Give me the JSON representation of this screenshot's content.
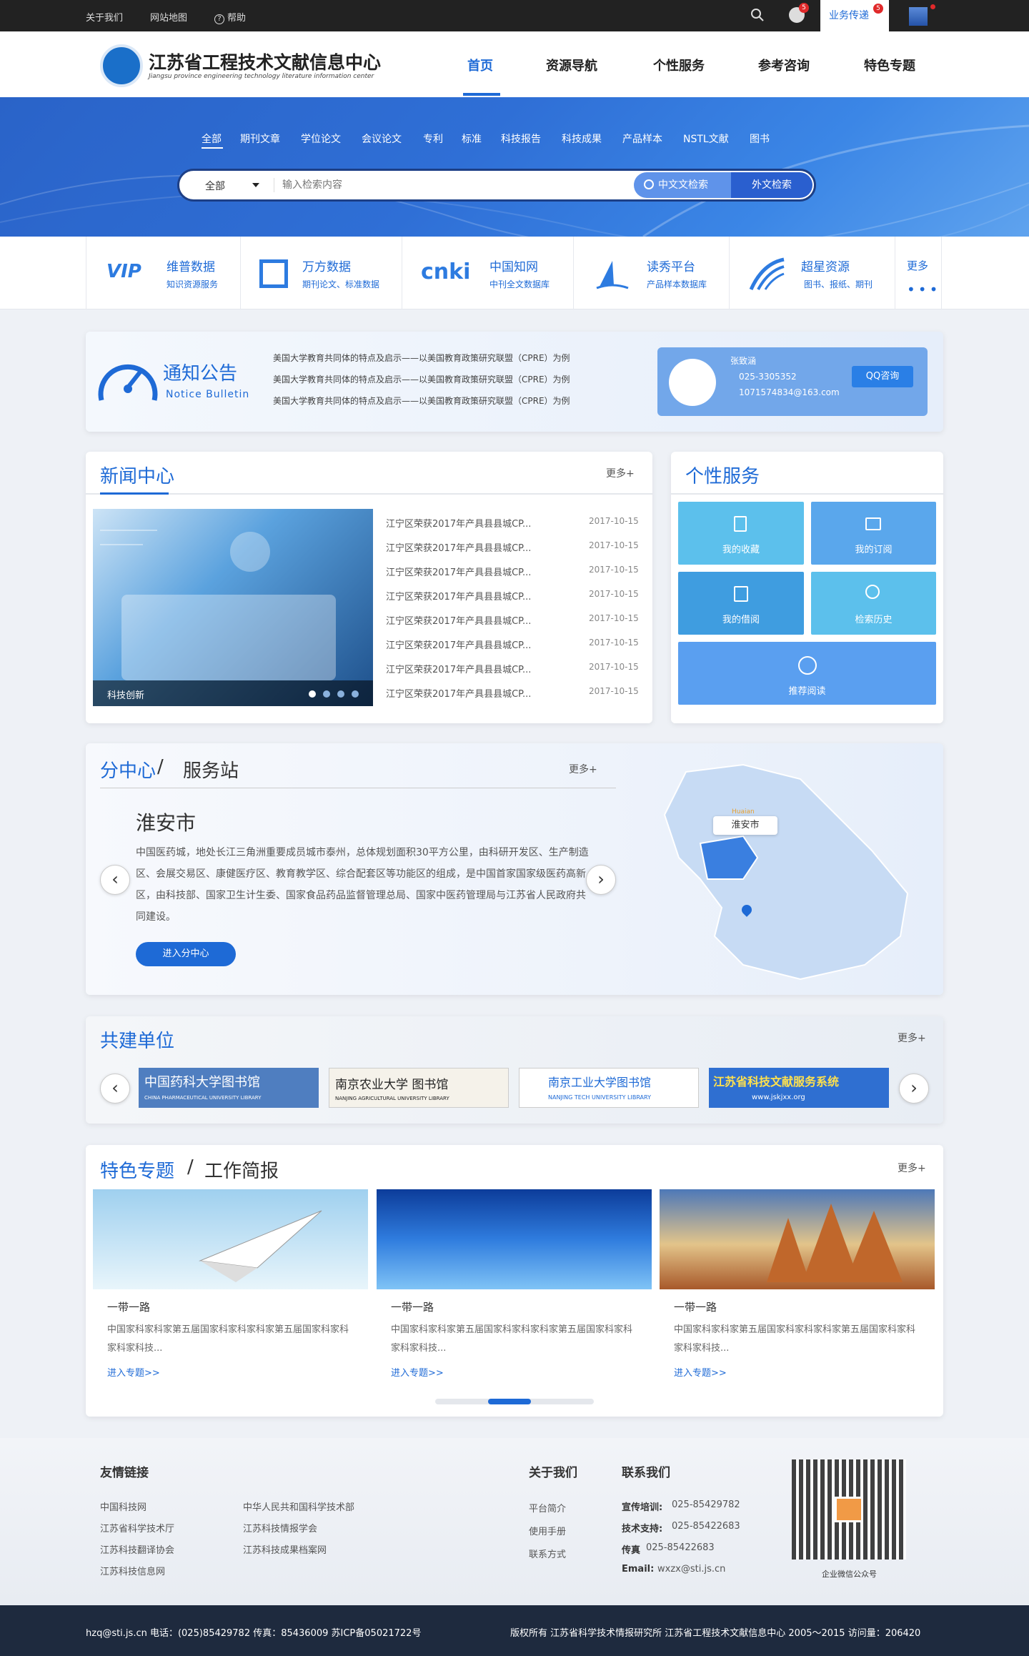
{
  "topbar": {
    "links": [
      "关于我们",
      "网站地图",
      "帮助"
    ],
    "badge_notice": "5",
    "business_tab": "业务传递",
    "badge_business": "5"
  },
  "header": {
    "title": "江苏省工程技术文献信息中心",
    "subtitle": "Jiangsu province engineering technology literature information center",
    "nav": [
      "首页",
      "资源导航",
      "个性服务",
      "参考咨询",
      "特色专题"
    ]
  },
  "search": {
    "categories": [
      "全部",
      "期刊文章",
      "学位论文",
      "会议论文",
      "专利",
      "标准",
      "科技报告",
      "科技成果",
      "产品样本",
      "NSTL文献",
      "图书"
    ],
    "select_value": "全部",
    "placeholder": "输入检索内容",
    "btn_cn": "中文文检索",
    "btn_foreign": "外文检索"
  },
  "quick_links": [
    {
      "title": "维普数据",
      "sub": "知识资源服务",
      "logo": "VIP"
    },
    {
      "title": "万方数据",
      "sub": "期刊论文、标准数据",
      "logo": "WF"
    },
    {
      "title": "中国知网",
      "sub": "中刊全文数据库",
      "logo": "cnki"
    },
    {
      "title": "读秀平台",
      "sub": "产品样本数据库",
      "logo": "DX"
    },
    {
      "title": "超星资源",
      "sub": "图书、报纸、期刊",
      "logo": "CX"
    }
  ],
  "quick_more": "更多",
  "notice": {
    "title_cn": "通知公告",
    "title_en": "Notice Bulletin",
    "items": [
      "美国大学教育共同体的特点及启示——以美国教育政策研究联盟（CPRE）为例",
      "美国大学教育共同体的特点及启示——以美国教育政策研究联盟（CPRE）为例",
      "美国大学教育共同体的特点及启示——以美国教育政策研究联盟（CPRE）为例"
    ],
    "contact_name": "张致涵",
    "contact_phone": "025-3305352",
    "contact_email": "1071574834@163.com",
    "qq_button": "QQ咨询"
  },
  "news": {
    "title": "新闻中心",
    "more": "更多+",
    "caption": "科技创新",
    "items": [
      {
        "text": "江宁区荣获2017年产具县县城CP...",
        "date": "2017-10-15"
      },
      {
        "text": "江宁区荣获2017年产具县县城CP...",
        "date": "2017-10-15"
      },
      {
        "text": "江宁区荣获2017年产具县县城CP...",
        "date": "2017-10-15"
      },
      {
        "text": "江宁区荣获2017年产具县县城CP...",
        "date": "2017-10-15"
      },
      {
        "text": "江宁区荣获2017年产具县县城CP...",
        "date": "2017-10-15"
      },
      {
        "text": "江宁区荣获2017年产具县县城CP...",
        "date": "2017-10-15"
      },
      {
        "text": "江宁区荣获2017年产具县县城CP...",
        "date": "2017-10-15"
      },
      {
        "text": "江宁区荣获2017年产具县县城CP...",
        "date": "2017-10-15"
      }
    ]
  },
  "service": {
    "title": "个性服务",
    "tiles": [
      "我的收藏",
      "我的订阅",
      "我的借阅",
      "检索历史",
      "推荐阅读"
    ]
  },
  "branch": {
    "title_a": "分中心",
    "sep": "/",
    "title_b": "服务站",
    "more": "更多+",
    "city": "淮安市",
    "desc": "中国医药城，地处长江三角洲重要成员城市泰州，总体规划面积30平方公里，由科研开发区、生产制造区、会展交易区、康健医疗区、教育教学区、综合配套区等功能区的组成，是中国首家国家级医药高新区，由科技部、国家卫生计生委、国家食品药品监督管理总局、国家中医药管理局与江苏省人民政府共同建设。",
    "button": "进入分中心",
    "map_tag_en": "Huaian",
    "map_tag_cn": "淮安市"
  },
  "partners": {
    "title": "共建单位",
    "more": "更多+",
    "logos": [
      {
        "name": "中国药科大学图书馆",
        "en": "CHINA PHARMACEUTICAL UNIVERSITY LIBRARY"
      },
      {
        "name": "南京农业大学 图书馆",
        "en": "NANJING AGRICULTURAL UNIVERSITY LIBRARY"
      },
      {
        "name": "南京工业大学图书馆",
        "en": "NANJING TECH UNIVERSITY LIBRARY"
      },
      {
        "name": "江苏省科技文献服务系统",
        "en": "www.jskjxx.org"
      }
    ]
  },
  "special": {
    "title_a": "特色专题",
    "sep": "/",
    "title_b": "工作简报",
    "more": "更多+",
    "cards": [
      {
        "title": "一带一路",
        "desc": "中国家科家科家第五届国家科家科家科家第五届国家科家科家科家科技...",
        "link": "进入专题>>"
      },
      {
        "title": "一带一路",
        "desc": "中国家科家科家第五届国家科家科家科家第五届国家科家科家科家科技...",
        "link": "进入专题>>"
      },
      {
        "title": "一带一路",
        "desc": "中国家科家科家第五届国家科家科家科家第五届国家科家科家科家科技...",
        "link": "进入专题>>"
      }
    ]
  },
  "footer": {
    "links_title": "友情链接",
    "links_col1": [
      "中国科技网",
      "江苏省科学技术厅",
      "江苏科技翻译协会",
      "江苏科技信息网"
    ],
    "links_col2": [
      "中华人民共和国科学技术部",
      "江苏科技情报学会",
      "江苏科技成果档案网"
    ],
    "about_title": "关于我们",
    "about_items": [
      "平台简介",
      "使用手册",
      "联系方式"
    ],
    "contact_title": "联系我们",
    "contact_lines": [
      {
        "label": "宣传培训:",
        "value": "025-85429782"
      },
      {
        "label": "技术支持:",
        "value": "025-85422683"
      },
      {
        "label": "传真",
        "value": "025-85422683"
      },
      {
        "label": "Email:",
        "value": "wxzx@sti.js.cn"
      }
    ],
    "qr_caption": "企业微信公众号",
    "bottom_left": "hzq@sti.js.cn 电话：(025)85429782 传真：85436009 苏ICP备05021722号",
    "bottom_right": "版权所有 江苏省科学技术情报研究所 江苏省工程技术文献信息中心 2005～2015 访问量：206420"
  },
  "colors": {
    "accent": "#1e6ad6",
    "topbar": "#222222",
    "footer": "#1e2a3e"
  }
}
